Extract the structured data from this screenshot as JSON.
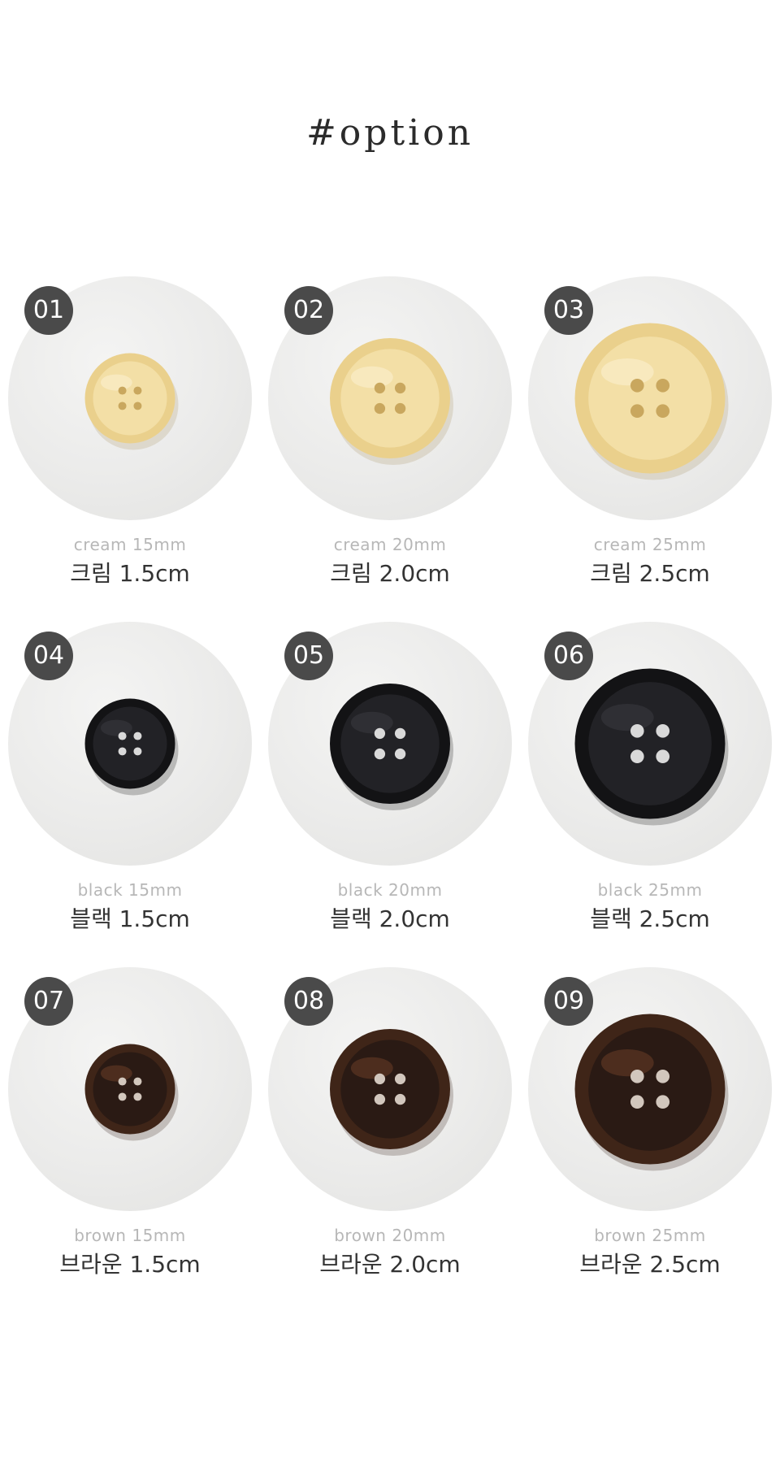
{
  "header": {
    "title": "#option"
  },
  "options": [
    {
      "number": "01",
      "sub": "cream 15mm",
      "label": "크림 1.5cm",
      "color": "cream",
      "diameter_mm": 15
    },
    {
      "number": "02",
      "sub": "cream 20mm",
      "label": "크림 2.0cm",
      "color": "cream",
      "diameter_mm": 20
    },
    {
      "number": "03",
      "sub": "cream 25mm",
      "label": "크림 2.5cm",
      "color": "cream",
      "diameter_mm": 25
    },
    {
      "number": "04",
      "sub": "black 15mm",
      "label": "블랙 1.5cm",
      "color": "black",
      "diameter_mm": 15
    },
    {
      "number": "05",
      "sub": "black 20mm",
      "label": "블랙 2.0cm",
      "color": "black",
      "diameter_mm": 20
    },
    {
      "number": "06",
      "sub": "black 25mm",
      "label": "블랙 2.5cm",
      "color": "black",
      "diameter_mm": 25
    },
    {
      "number": "07",
      "sub": "brown 15mm",
      "label": "브라운 1.5cm",
      "color": "brown",
      "diameter_mm": 15
    },
    {
      "number": "08",
      "sub": "brown 20mm",
      "label": "브라운 2.0cm",
      "color": "brown",
      "diameter_mm": 20
    },
    {
      "number": "09",
      "sub": "brown 25mm",
      "label": "브라운 2.5cm",
      "color": "brown",
      "diameter_mm": 25
    }
  ],
  "colors": {
    "cream": "#f2dda0",
    "black": "#1c1c1e",
    "brown": "#3b2318",
    "badge": "#4a4a4a"
  }
}
